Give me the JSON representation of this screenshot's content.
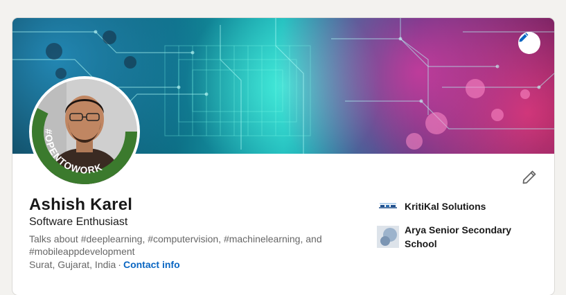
{
  "profile": {
    "name": "Ashish Karel",
    "headline": "Software Enthusiast",
    "about": "Talks about #deeplearning, #computervision, #machinelearning, and #mobileappdevelopment",
    "location": "Surat, Gujarat, India",
    "separator": "·",
    "contact_label": "Contact info",
    "open_to_work_badge": "#OPENTOWORK"
  },
  "organizations": [
    {
      "name": "KritiKal Solutions",
      "logo_icon": "kritikal-logo"
    },
    {
      "name": "Arya Senior Secondary School",
      "logo_icon": "school-logo"
    }
  ],
  "icons": {
    "banner_edit": "pencil-icon",
    "profile_edit": "pencil-icon"
  },
  "colors": {
    "link": "#0a66c2",
    "open_to_work_green": "#3b7a2d",
    "page_background": "#f3f2ef"
  }
}
